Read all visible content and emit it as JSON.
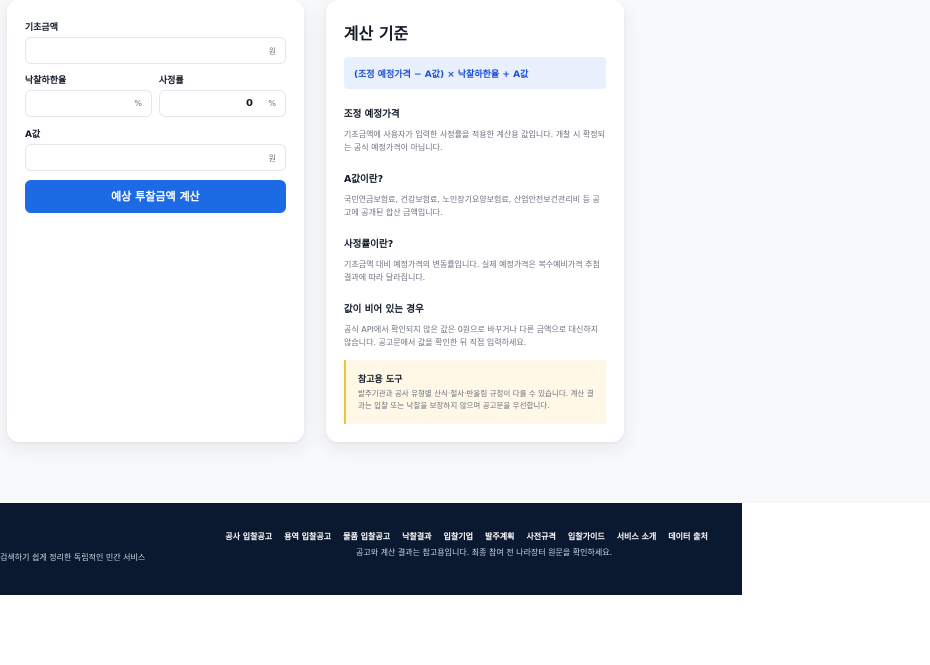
{
  "form": {
    "base_amount": {
      "label": "기초금액",
      "value": "",
      "unit": "원"
    },
    "success_rate": {
      "label": "낙찰하한율",
      "value": "",
      "unit": "%"
    },
    "assessment_rate": {
      "label": "사정률",
      "value": "0",
      "unit": "%"
    },
    "a_value": {
      "label": "A값",
      "value": "",
      "unit": "원"
    },
    "calculate_button": "예상 투찰금액 계산"
  },
  "info": {
    "title": "계산 기준",
    "formula": "(조정 예정가격 − A값) × 낙찰하한율 + A값",
    "sections": [
      {
        "title": "조정 예정가격",
        "body": "기초금액에 사용자가 입력한 사정률을 적용한 계산용 값입니다. 개찰 시 확정되는 공식 예정가격이 아닙니다."
      },
      {
        "title": "A값이란?",
        "body": "국민연금보험료, 건강보험료, 노인장기요양보험료, 산업안전보건관리비 등 공고에 공개된 합산 금액입니다."
      },
      {
        "title": "사정률이란?",
        "body": "기초금액 대비 예정가격의 변동률입니다. 실제 예정가격은 복수예비가격 추첨 결과에 따라 달라집니다."
      },
      {
        "title": "값이 비어 있는 경우",
        "body": "공식 API에서 확인되지 않은 값은 0원으로 바꾸거나 다른 금액으로 대신하지 않습니다. 공고문에서 값을 확인한 뒤 직접 입력하세요."
      }
    ],
    "note": {
      "title": "참고용 도구",
      "body": "발주기관과 공사 유형별 산식·절사·반올림 규정이 다를 수 있습니다. 계산 결과는 입찰 또는 낙찰을 보장하지 않으며 공고문을 우선합니다."
    }
  },
  "footer": {
    "description": "검색하기 쉽게 정리한 독립적인 민간 서비스",
    "links": [
      "공사 입찰공고",
      "용역 입찰공고",
      "물품 입찰공고",
      "낙찰결과",
      "입찰기업",
      "발주계획",
      "사전규격",
      "입찰가이드",
      "서비스 소개",
      "데이터 출처"
    ],
    "note": "공고와 계산 결과는 참고용입니다. 최종 참여 전 나라장터 원문을 확인하세요."
  }
}
